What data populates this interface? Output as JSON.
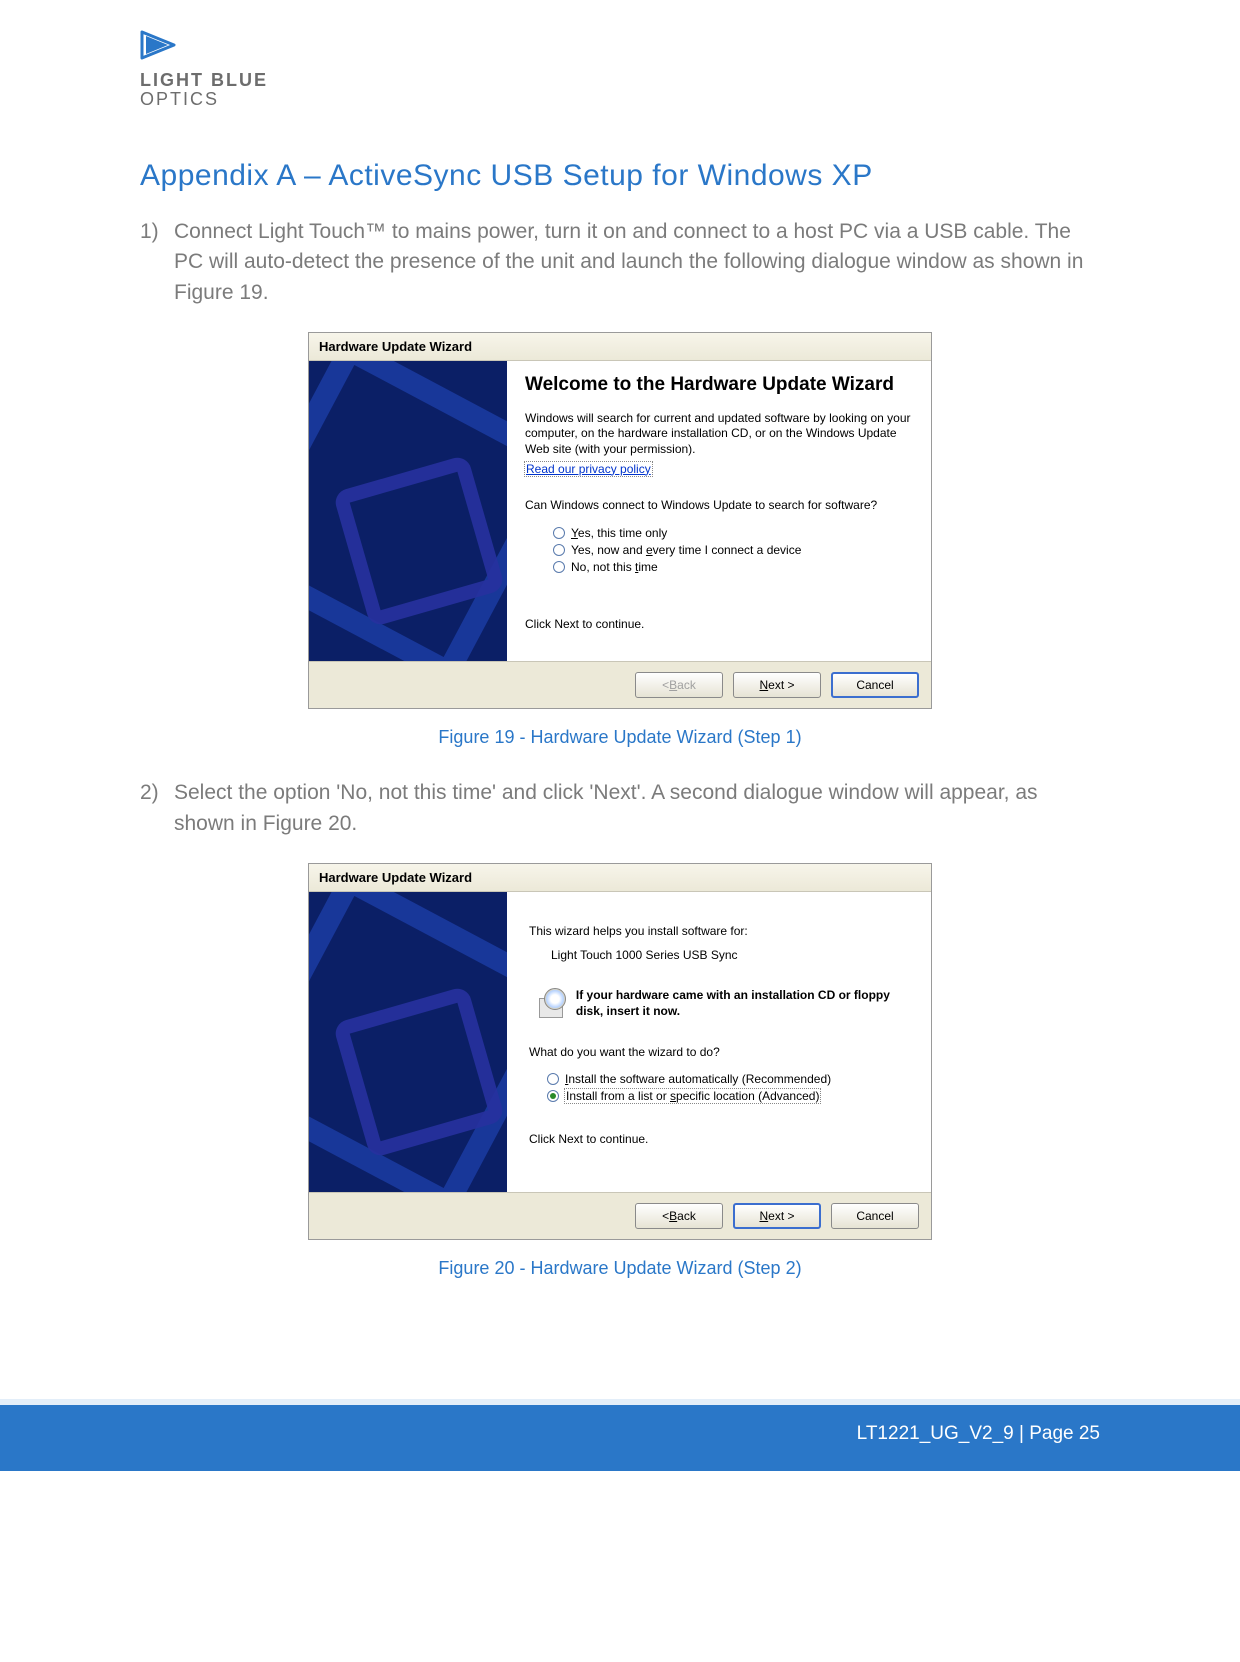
{
  "brand": {
    "line1": "LIGHT BLUE",
    "line2": "OPTICS"
  },
  "heading": "Appendix A – ActiveSync USB Setup for Windows XP",
  "step1": {
    "num": "1)",
    "text": "Connect Light Touch™ to mains power, turn it on and connect to a host PC via a USB cable. The PC will auto-detect the presence of the unit and launch the following dialogue window as shown in Figure 19."
  },
  "dialog1": {
    "title": "Hardware Update Wizard",
    "heading": "Welcome to the Hardware Update Wizard",
    "intro": "Windows will search for current and updated software by looking on your computer, on the hardware installation CD, or on the Windows Update Web site (with your permission).",
    "privacy": "Read our privacy policy",
    "question": "Can Windows connect to Windows Update to search for software?",
    "options": {
      "a_pre": "",
      "a_u": "Y",
      "a_post": "es, this time only",
      "b_pre": "Yes, now and ",
      "b_u": "e",
      "b_post": "very time I connect a device",
      "c_pre": "No, not this ",
      "c_u": "t",
      "c_post": "ime"
    },
    "continue": "Click Next to continue.",
    "buttons": {
      "back_lt": "< ",
      "back_u": "B",
      "back_post": "ack",
      "next_u": "N",
      "next_post": "ext >",
      "cancel": "Cancel"
    }
  },
  "caption1": "Figure 19 - Hardware Update Wizard (Step 1)",
  "step2": {
    "num": "2)",
    "text": "Select the option 'No, not this time' and click 'Next'. A second dialogue window will appear, as shown in Figure 20."
  },
  "dialog2": {
    "title": "Hardware Update Wizard",
    "line1": "This wizard helps you install software for:",
    "device": "Light Touch 1000 Series USB Sync",
    "cd_text": "If your hardware came with an installation CD or floppy disk, insert it now.",
    "question": "What do you want the wizard to do?",
    "options": {
      "a_u": "I",
      "a_post": "nstall the software automatically (Recommended)",
      "b_pre": "Install from a list or ",
      "b_u": "s",
      "b_post": "pecific location (Advanced)"
    },
    "continue": "Click Next to continue.",
    "buttons": {
      "back_lt": "< ",
      "back_u": "B",
      "back_post": "ack",
      "next_u": "N",
      "next_post": "ext >",
      "cancel": "Cancel"
    }
  },
  "caption2": "Figure 20 - Hardware Update Wizard (Step 2)",
  "footer": "LT1221_UG_V2_9 | Page 25"
}
